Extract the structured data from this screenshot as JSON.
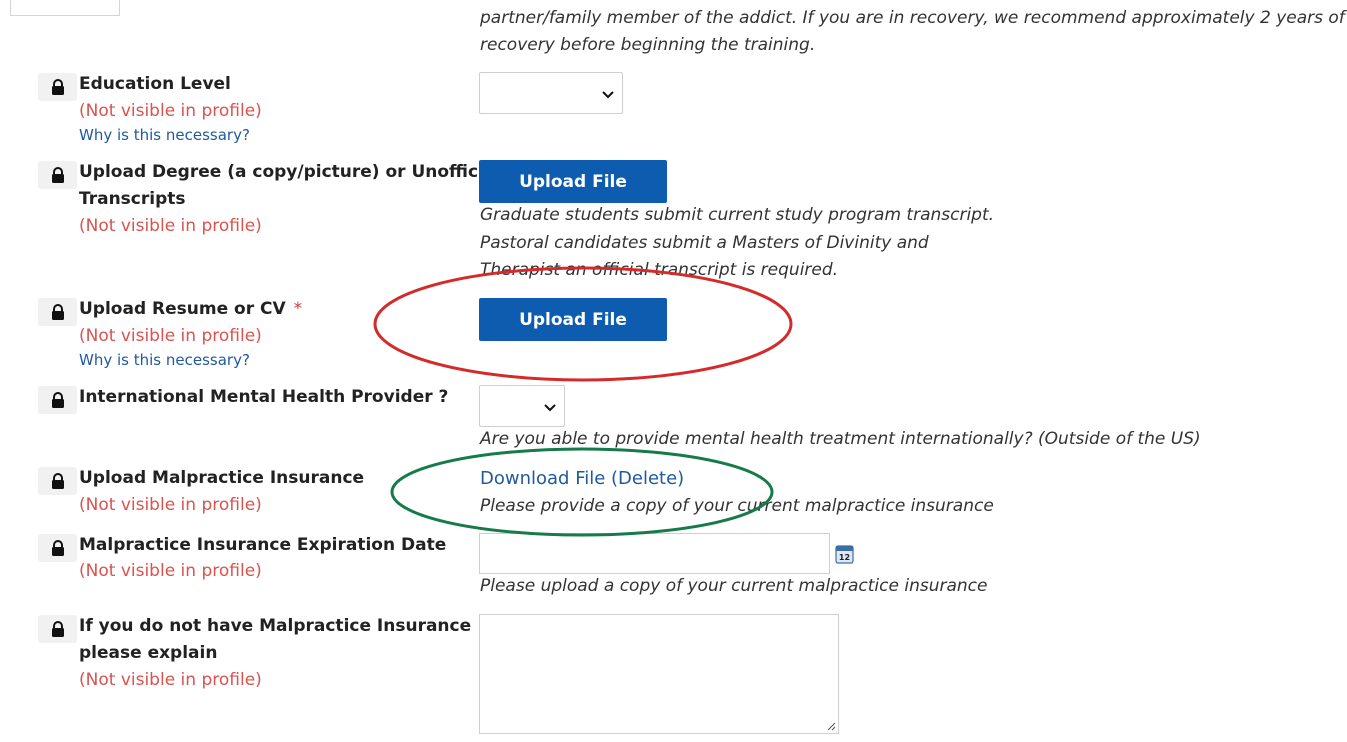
{
  "top_help": {
    "line1": "partner/family member of the addict. If you are in recovery, we recommend approximately 2 years of",
    "line2": "recovery before beginning the training."
  },
  "fields": {
    "education": {
      "label": "Education Level",
      "not_visible": "(Not visible in profile)",
      "why": "Why is this necessary?",
      "value": ""
    },
    "degree": {
      "label_line1": "Upload Degree (a copy/picture) or Unofficial",
      "label_line2": "Transcripts",
      "not_visible": "(Not visible in profile)",
      "button": "Upload File",
      "help1": "Graduate students submit current study program transcript.",
      "help2": "Pastoral candidates submit a Masters of Divinity and",
      "help3": "Therapist an official transcript is required."
    },
    "resume": {
      "label": "Upload Resume or CV",
      "required": "*",
      "not_visible": "(Not visible in profile)",
      "why": "Why is this necessary?",
      "button": "Upload File"
    },
    "international": {
      "label": "International Mental Health Provider ?",
      "value": "",
      "help": "Are you able to provide mental health treatment internationally? (Outside of the US)"
    },
    "malpractice": {
      "label": "Upload Malpractice Insurance",
      "not_visible": "(Not visible in profile)",
      "download": "Download File",
      "delete": "(Delete)",
      "help": "Please provide a copy of your current malpractice insurance"
    },
    "expiration": {
      "label": "Malpractice Insurance Expiration Date",
      "not_visible": "(Not visible in profile)",
      "value": "",
      "calendar_day": "12",
      "help": "Please upload a copy of your current malpractice insurance"
    },
    "explain": {
      "label_line1": "If you do not have Malpractice Insurance",
      "label_line2": "please explain",
      "not_visible": "(Not visible in profile)",
      "value": ""
    }
  },
  "annotations": {
    "red_ellipse_color": "#d42a2a",
    "green_ellipse_color": "#167a4a"
  },
  "colors": {
    "button_bg": "#0d5cb0",
    "not_visible": "#d9534f",
    "link": "#1f5a9e"
  }
}
